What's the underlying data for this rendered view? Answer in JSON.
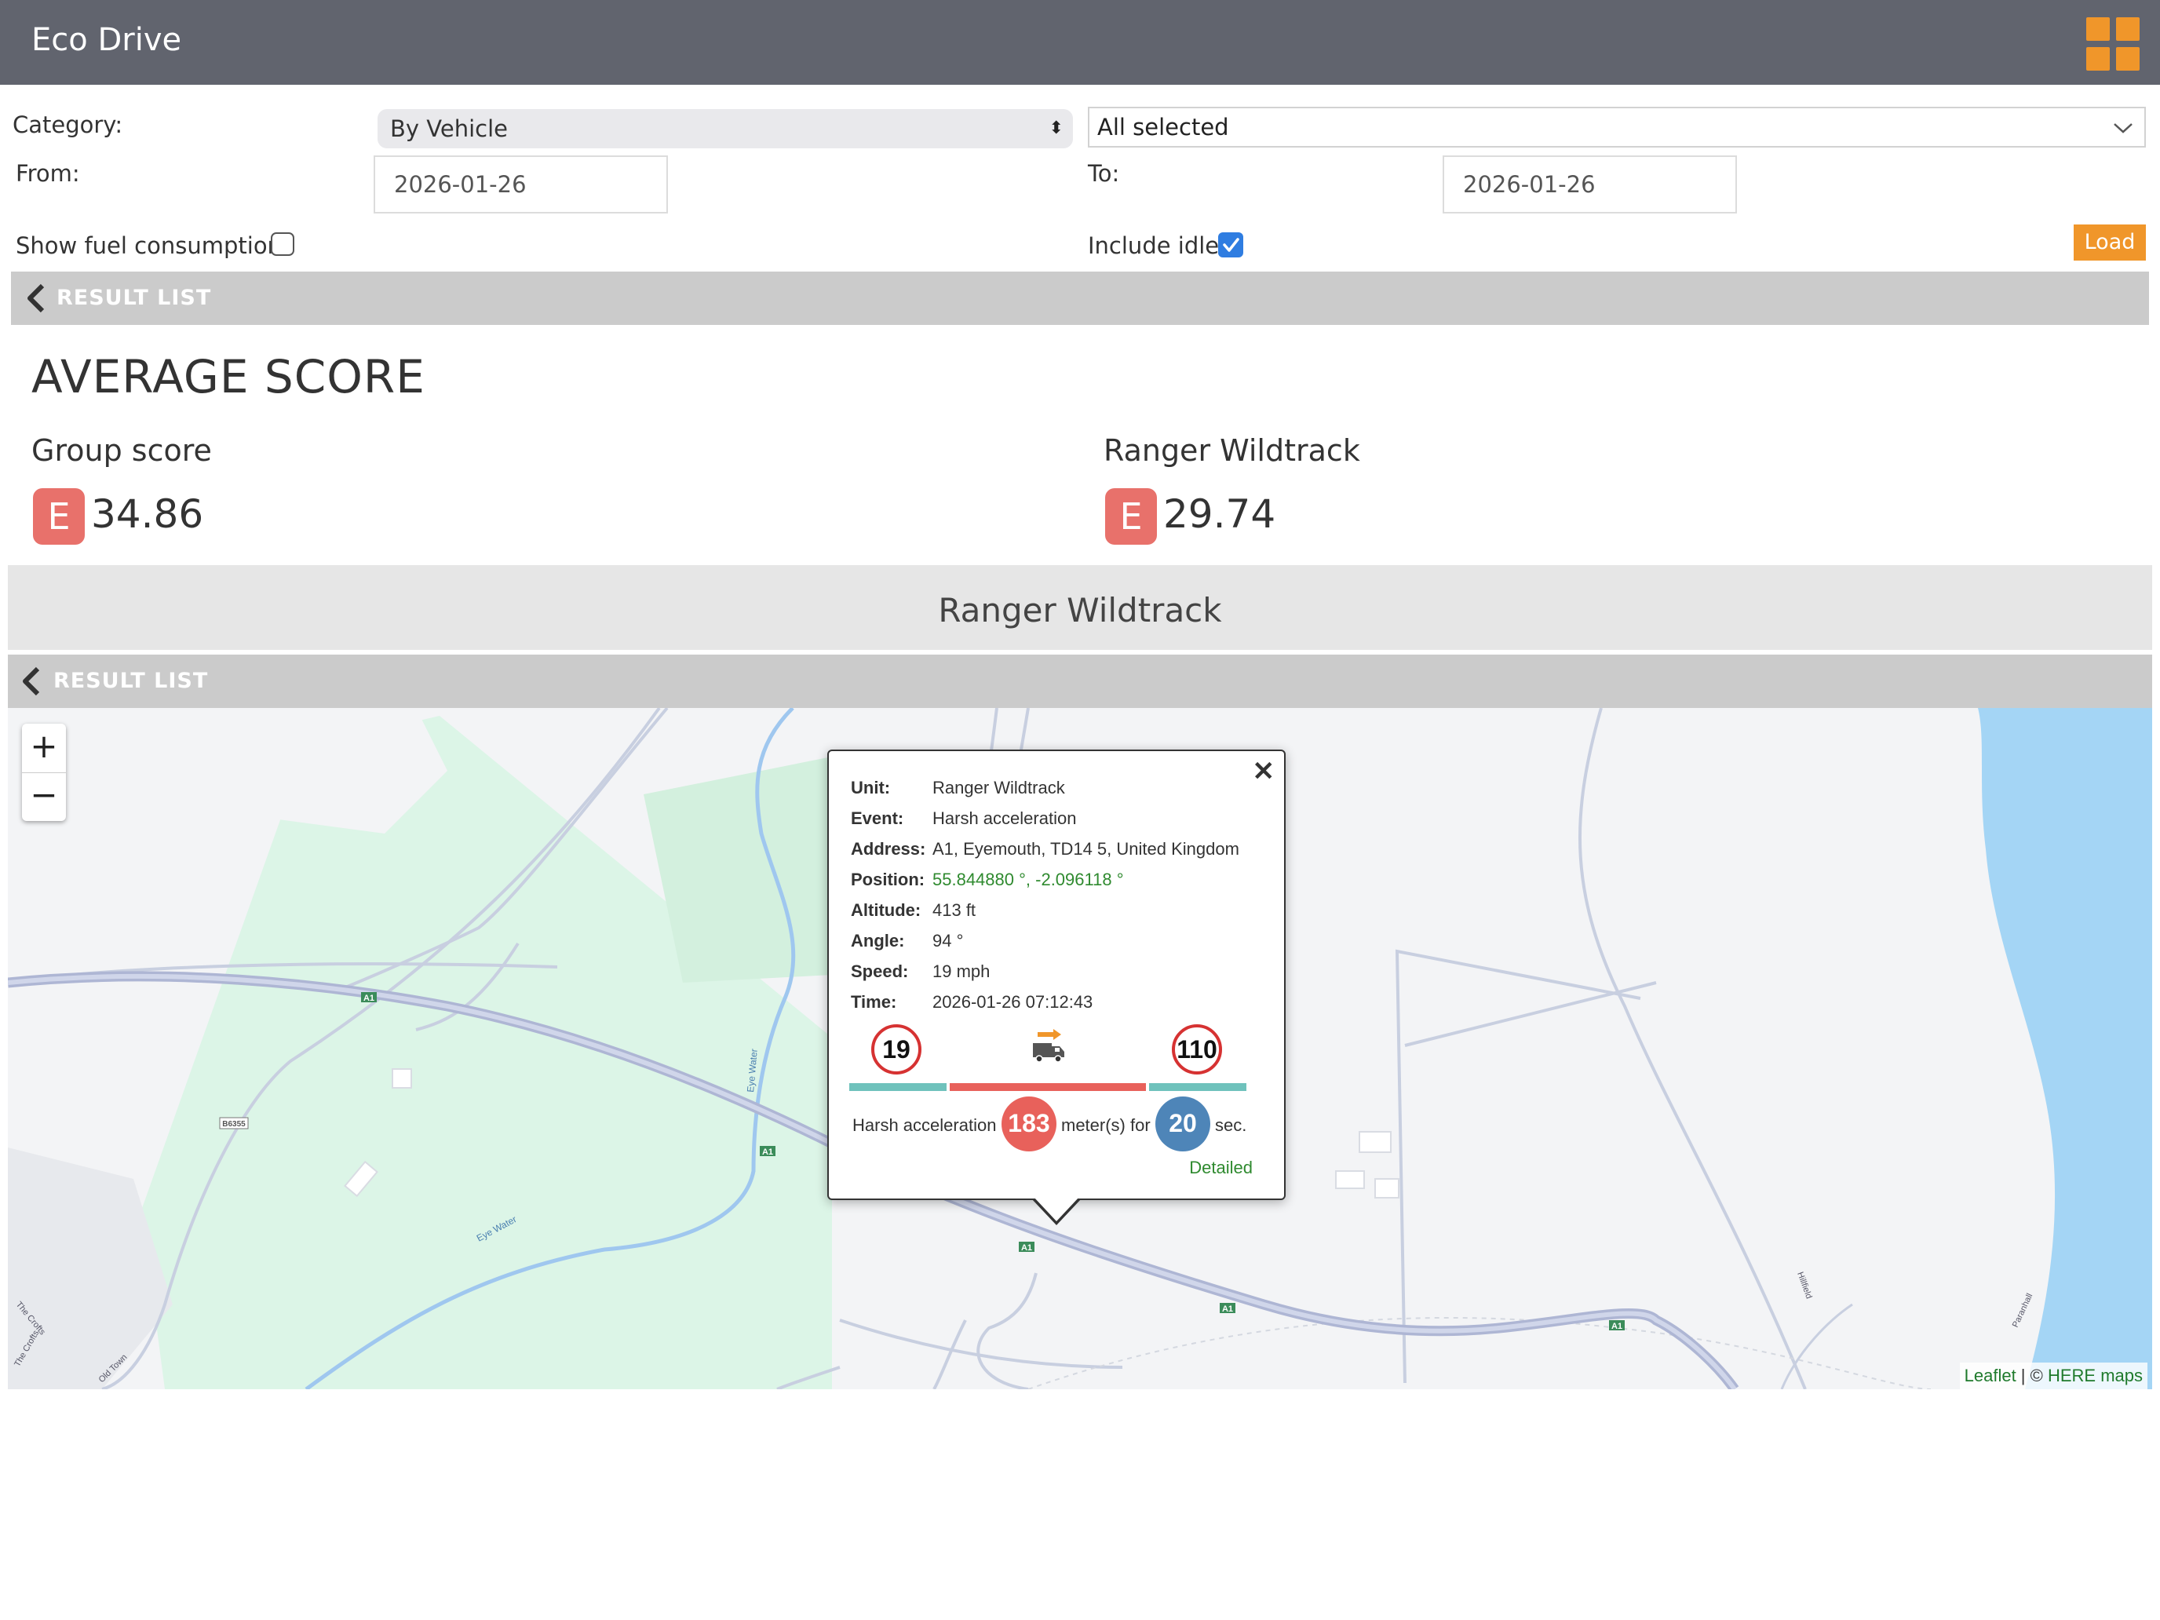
{
  "header": {
    "title": "Eco Drive",
    "menu_icon": "grid-menu-icon"
  },
  "form": {
    "category_label": "Category:",
    "category_value": "By Vehicle",
    "vehicles_value": "All selected",
    "from_label": "From:",
    "from_value": "2026-01-26",
    "to_label": "To:",
    "to_value": "2026-01-26",
    "fuel_label": "Show fuel consumption:",
    "fuel_checked": false,
    "idle_label": "Include idle:",
    "idle_checked": true,
    "load_label": "Load"
  },
  "result_list_label": "RESULT LIST",
  "average": {
    "title": "AVERAGE SCORE",
    "group_label": "Group score",
    "group_grade": "E",
    "group_score": "34.86",
    "vehicle_label": "Ranger Wildtrack",
    "vehicle_grade": "E",
    "vehicle_score": "29.74"
  },
  "vehicle_banner": "Ranger Wildtrack",
  "map": {
    "zoom_in": "+",
    "zoom_out": "−",
    "attribution_leaflet": "Leaflet",
    "attribution_sep": " | © ",
    "attribution_here": "HERE maps",
    "road_labels": [
      "A1",
      "A1",
      "A1",
      "A1",
      "A1",
      "B6355",
      "Eye Water",
      "Eye Water",
      "The Crofts",
      "The Crofts",
      "Old Town",
      "Hillfield",
      "Paranhall"
    ]
  },
  "popup": {
    "rows": [
      {
        "key": "Unit:",
        "value": "Ranger Wildtrack"
      },
      {
        "key": "Event:",
        "value": "Harsh acceleration"
      },
      {
        "key": "Address:",
        "value": "A1, Eyemouth, TD14 5, United Kingdom"
      },
      {
        "key": "Position:",
        "value": "55.844880 °, -2.096118 °"
      },
      {
        "key": "Altitude:",
        "value": "413 ft"
      },
      {
        "key": "Angle:",
        "value": "94 °"
      },
      {
        "key": "Speed:",
        "value": "19 mph"
      },
      {
        "key": "Time:",
        "value": "2026-01-26 07:12:43"
      }
    ],
    "speed_start": "19",
    "speed_limit": "110",
    "event_text": "Harsh acceleration",
    "distance": "183",
    "distance_unit": "meter(s) for",
    "duration": "20",
    "duration_unit": "sec.",
    "detailed_link": "Detailed",
    "close_icon": "close-icon",
    "truck_icon": "truck-accelerating-icon",
    "colors": {
      "teal": "#6fc2bc",
      "red": "#e8615b",
      "blue": "#4e85b8",
      "green": "#2f8a2f"
    }
  }
}
